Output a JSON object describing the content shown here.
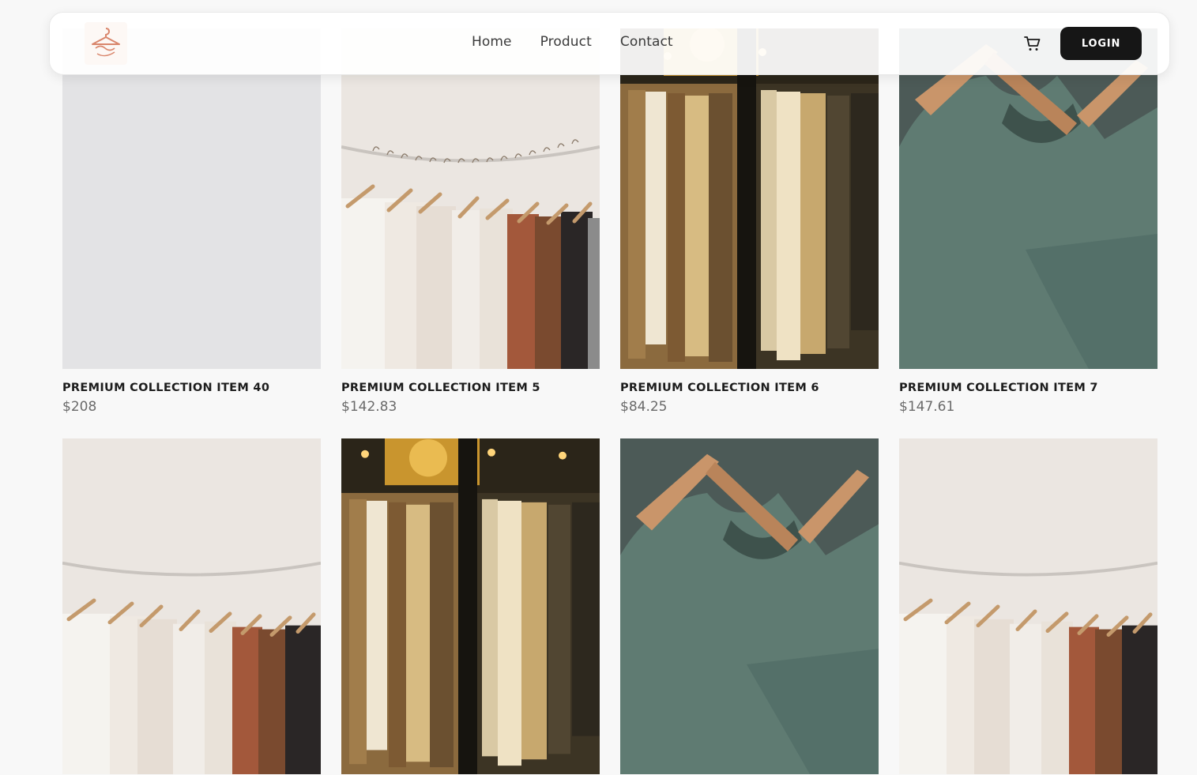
{
  "header": {
    "logo_icon": "hanger-brand-logo",
    "nav": [
      "Home",
      "Product",
      "Contact"
    ],
    "cart_icon": "cart-icon",
    "login_label": "LOGIN"
  },
  "products": [
    {
      "title": "PREMIUM COLLECTION ITEM 40",
      "price": "$208",
      "image": "placeholder"
    },
    {
      "title": "PREMIUM COLLECTION ITEM 5",
      "price": "$142.83",
      "image": "white-rack"
    },
    {
      "title": "PREMIUM COLLECTION ITEM 6",
      "price": "$84.25",
      "image": "warm-closet"
    },
    {
      "title": "PREMIUM COLLECTION ITEM 7",
      "price": "$147.61",
      "image": "green-tee"
    },
    {
      "image": "white-rack"
    },
    {
      "image": "warm-closet"
    },
    {
      "image": "green-tee"
    },
    {
      "image": "white-rack"
    }
  ],
  "colors": {
    "accent": "#161616",
    "background": "#f8f8f8",
    "logo": "#d9866c",
    "price": "#6a6a6a"
  }
}
